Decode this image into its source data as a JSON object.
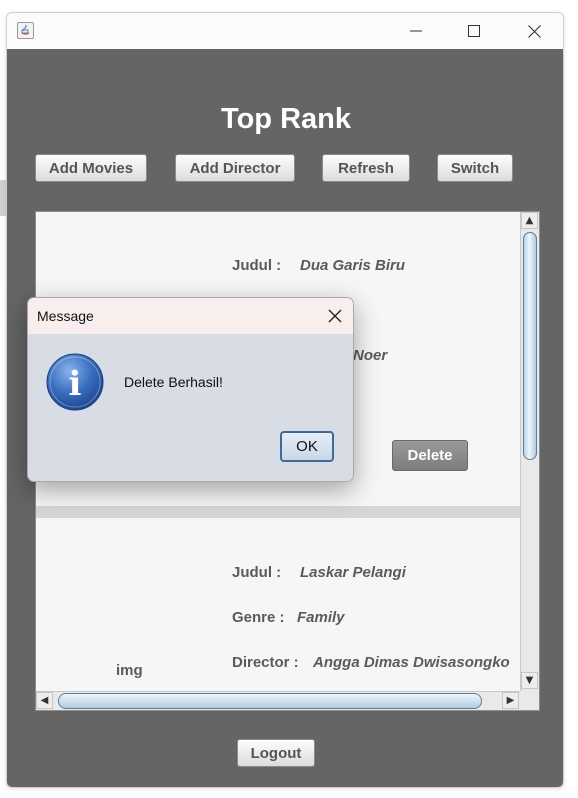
{
  "window": {
    "minimize_glyph": "—",
    "maximize_glyph": "☐",
    "close_glyph": "✕"
  },
  "page": {
    "title": "Top Rank"
  },
  "toolbar": {
    "add_movies": "Add Movies",
    "add_director": "Add Director",
    "refresh": "Refresh",
    "switch": "Switch"
  },
  "movies": [
    {
      "judul_label": "Judul :",
      "judul": "Dua Garis Biru",
      "director_partial": "Noer",
      "delete_label": "Delete"
    },
    {
      "image_placeholder": "img",
      "judul_label": "Judul :",
      "judul": "Laskar Pelangi",
      "genre_label": "Genre :",
      "genre": "Family",
      "director_label": "Director :",
      "director": "Angga Dimas Dwisasongko"
    }
  ],
  "scrollbars": {
    "up_arrow": "▲",
    "down_arrow": "▼",
    "left_arrow": "◀",
    "right_arrow": "▶"
  },
  "footer": {
    "logout": "Logout"
  },
  "dialog": {
    "title": "Message",
    "message": "Delete Berhasil!",
    "ok_label": "OK",
    "icon_glyph": "i"
  },
  "icons": {
    "app": "java-app-icon",
    "info": "information-icon",
    "close": "close-icon"
  },
  "colors": {
    "content_bg": "#656565",
    "card_bg": "#f6f6f6",
    "delete_button": "#8c8c8c",
    "dialog_bg": "#d8dce5",
    "dialog_titlebar": "#f8eeee",
    "info_blue": "#2f5ea8"
  }
}
